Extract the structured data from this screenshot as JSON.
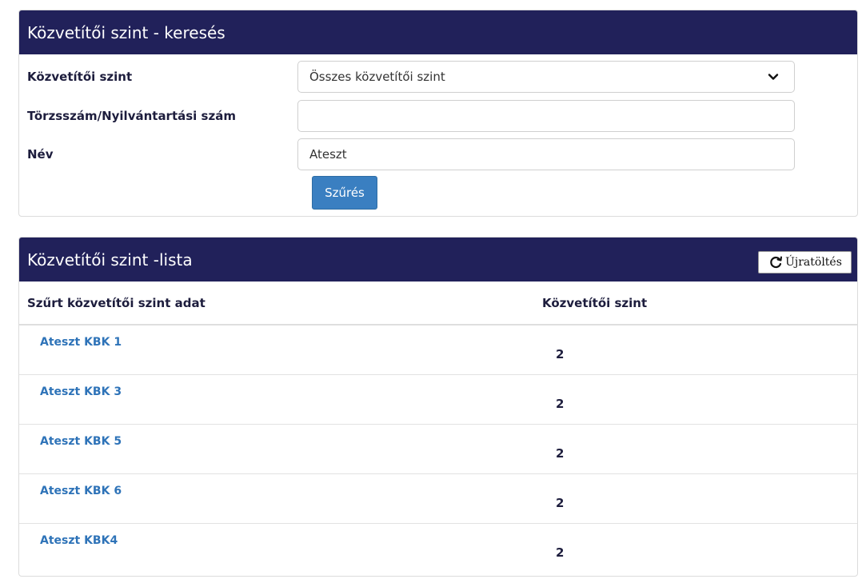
{
  "search": {
    "title": "Közvetítői szint - keresés",
    "level_label": "Közvetítői szint",
    "level_selected": "Összes közvetítői szint",
    "reg_label": "Törzsszám/Nyilvántartási szám",
    "reg_value": "",
    "name_label": "Név",
    "name_value": "Ateszt",
    "filter_button": "Szűrés"
  },
  "list": {
    "title": "Közvetítői szint -lista",
    "reload_button": "Újratöltés",
    "columns": {
      "name": "Szűrt közvetítői szint adat",
      "level": "Közvetítői szint"
    },
    "rows": [
      {
        "name": "Ateszt KBK 1",
        "level": "2"
      },
      {
        "name": "Ateszt KBK 3",
        "level": "2"
      },
      {
        "name": "Ateszt KBK 5",
        "level": "2"
      },
      {
        "name": "Ateszt KBK 6",
        "level": "2"
      },
      {
        "name": "Ateszt KBK4",
        "level": "2"
      }
    ]
  },
  "colors": {
    "header_bg": "#21215a",
    "link": "#2e73b8",
    "primary_button": "#3a7fc1"
  },
  "icons": {
    "select_arrow": "chevron-down-icon",
    "reload": "refresh-icon"
  }
}
